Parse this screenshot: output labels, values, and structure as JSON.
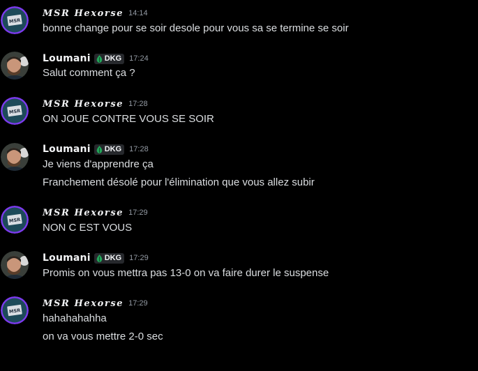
{
  "theme": {
    "background": "#000000",
    "text": "#dbdee1",
    "username": "#f2f3f5",
    "timestamp": "#949ba4",
    "tag_bg": "#26282c",
    "tag_icon": "#23a55a",
    "msr_ring": "#8b5cf6"
  },
  "messages": [
    {
      "author": "MSR Hexorse",
      "avatar": "msr-logo-avatar",
      "time": "14:14",
      "lines": [
        "bonne change pour se soir desole pour vous sa se termine se soir"
      ]
    },
    {
      "author": "Loumani",
      "avatar": "user-photo-avatar",
      "tag": "DKG",
      "tag_icon": "green-leaf-icon",
      "time": "17:24",
      "lines": [
        "Salut comment ça ?"
      ]
    },
    {
      "author": "MSR Hexorse",
      "avatar": "msr-logo-avatar",
      "time": "17:28",
      "lines": [
        "ON JOUE CONTRE VOUS SE SOIR"
      ]
    },
    {
      "author": "Loumani",
      "avatar": "user-photo-avatar",
      "tag": "DKG",
      "tag_icon": "green-leaf-icon",
      "time": "17:28",
      "lines": [
        "Je viens d'apprendre ça",
        "Franchement désolé pour l'élimination que vous allez subir"
      ]
    },
    {
      "author": "MSR Hexorse",
      "avatar": "msr-logo-avatar",
      "time": "17:29",
      "lines": [
        "NON C EST VOUS"
      ]
    },
    {
      "author": "Loumani",
      "avatar": "user-photo-avatar",
      "tag": "DKG",
      "tag_icon": "green-leaf-icon",
      "time": "17:29",
      "lines": [
        "Promis on vous mettra pas 13-0 on va faire durer le suspense"
      ]
    },
    {
      "author": "MSR Hexorse",
      "avatar": "msr-logo-avatar",
      "time": "17:29",
      "lines": [
        "hahahahahha",
        "on va vous mettre 2-0 sec"
      ]
    }
  ]
}
